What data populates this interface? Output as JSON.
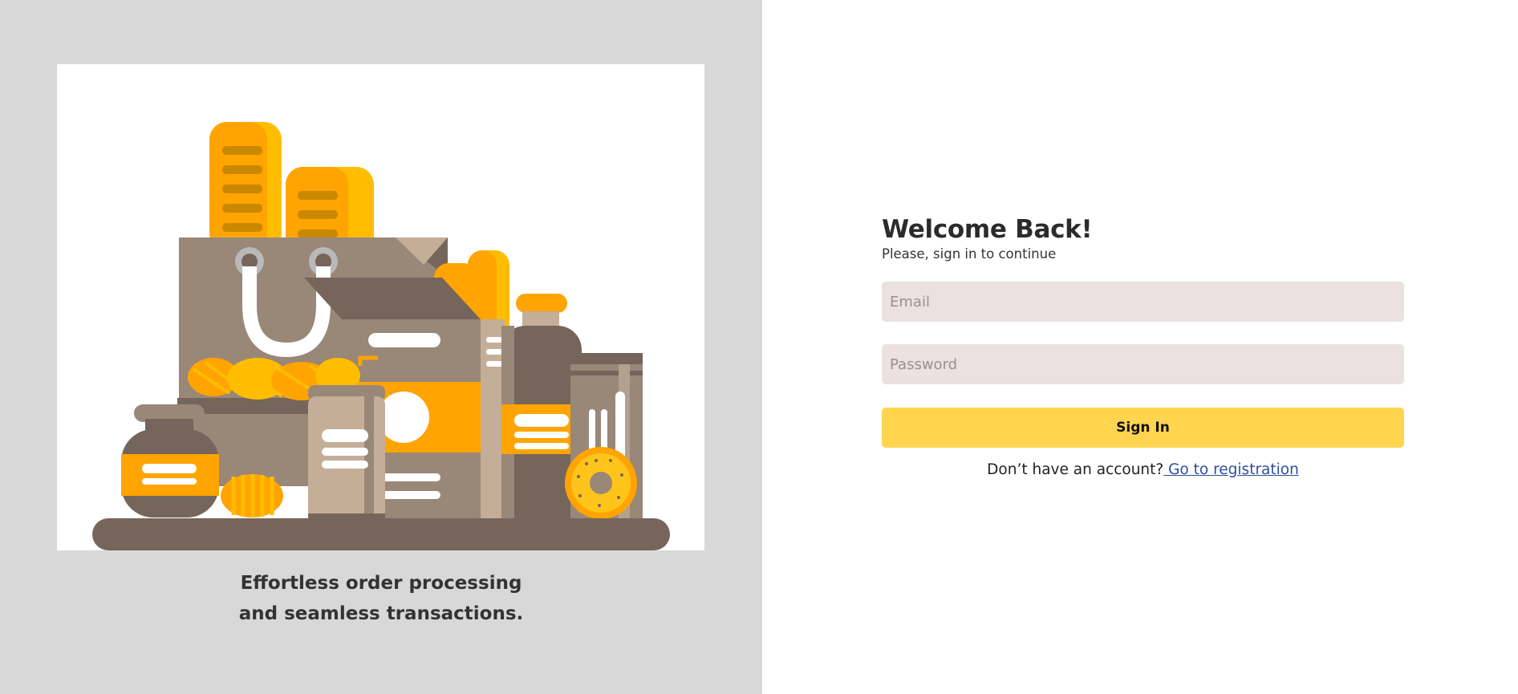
{
  "left": {
    "tagline_line1": "Effortless order processing",
    "tagline_line2": "and seamless transactions."
  },
  "form": {
    "title": "Welcome Back!",
    "subtitle": "Please, sign in to continue",
    "email_placeholder": "Email",
    "password_placeholder": "Password",
    "signin_label": "Sign In",
    "no_account_text": "Don’t have an account?",
    "register_link": " Go to registration"
  },
  "colors": {
    "left_bg": "#d8d8d8",
    "field_bg": "#ebe1e1",
    "accent_yellow": "#ffd44f",
    "illustration_orange": "#ffa400",
    "illustration_brown": "#76655a",
    "link_blue": "#2c4f9e"
  }
}
